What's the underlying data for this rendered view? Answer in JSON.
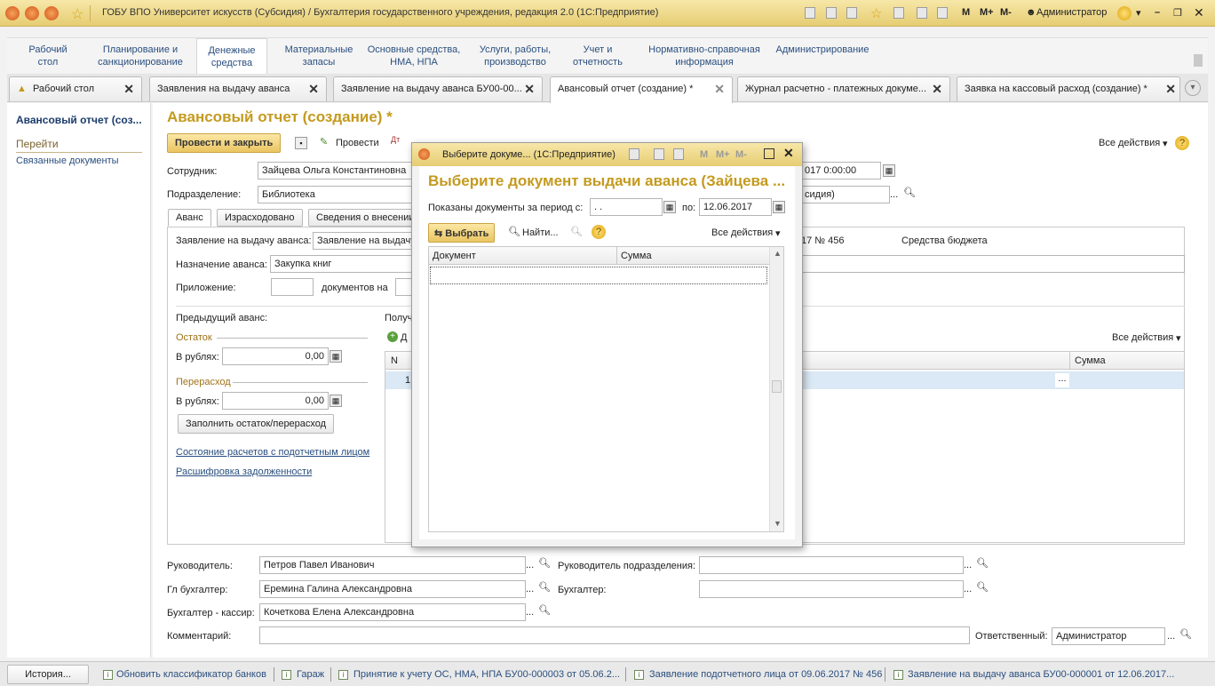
{
  "window": {
    "title": "ГОБУ ВПО Университет искусств (Субсидия) / Бухгалтерия государственного учреждения, редакция 2.0  (1С:Предприятие)",
    "right_buttons": [
      "M",
      "M+",
      "M-"
    ],
    "user": "Администратор"
  },
  "menu": [
    {
      "label": "Рабочий\nстол"
    },
    {
      "label": "Планирование и\nсанкционирование"
    },
    {
      "label": "Денежные\nсредства"
    },
    {
      "label": "Материальные\nзапасы"
    },
    {
      "label": "Основные средства,\nНМА, НПА"
    },
    {
      "label": "Услуги, работы,\nпроизводство"
    },
    {
      "label": "Учет и\nотчетность"
    },
    {
      "label": "Нормативно-справочная\nинформация"
    },
    {
      "label": "Администрирование"
    }
  ],
  "tabs": [
    {
      "label": "Рабочий стол"
    },
    {
      "label": "Заявления на выдачу аванса"
    },
    {
      "label": "Заявление на выдачу аванса БУ00-00..."
    },
    {
      "label": "Авансовый отчет (создание) *"
    },
    {
      "label": "Журнал расчетно - платежных докуме..."
    },
    {
      "label": "Заявка на кассовый расход (создание) *"
    }
  ],
  "left_panel": {
    "title": "Авансовый отчет (соз...",
    "goto": "Перейти",
    "related": "Связанные документы"
  },
  "form": {
    "title": "Авансовый отчет (создание) *",
    "post_close": "Провести и закрыть",
    "post": "Провести",
    "all_actions": "Все действия",
    "employee_label": "Сотрудник:",
    "employee_value": "Зайцева Ольга Константиновна",
    "date_value": "017 0:00:00",
    "dept_label": "Подразделение:",
    "dept_value": "Библиотека",
    "subsidy_value": "сидия)",
    "subtabs": [
      "Аванс",
      "Израсходовано",
      "Сведения о внесении"
    ],
    "advance_request_label": "Заявление на выдачу аванса:",
    "advance_request_value": "Заявление на выдачу",
    "advance_request_tail": "17 № 456",
    "budget_funds": "Средства бюджета",
    "purpose_label": "Назначение аванса:",
    "purpose_value": "Закупка книг",
    "attachment_label": "Приложение:",
    "documents_on": "документов на",
    "prev_advance": "Предыдущий аванс:",
    "received_partial": "Получ",
    "balance": "Остаток",
    "rub_label": "В рублях:",
    "balance_value": "0,00",
    "overspend": "Перерасход",
    "overspend_value": "0,00",
    "fill_button": "Заполнить остаток/перерасход",
    "link_status": "Состояние расчетов с подотчетным лицом",
    "link_debt": "Расшифровка задолженности",
    "add_partial": "Д",
    "all_actions2": "Все действия",
    "grid_n": "N",
    "grid_row_n": "1",
    "grid_sum": "Сумма",
    "head_label": "Руководитель:",
    "head_value": "Петров Павел Иванович",
    "dept_head_label": "Руководитель подразделения:",
    "chief_acc_label": "Гл бухгалтер:",
    "chief_acc_value": "Еремина Галина Александровна",
    "accountant_label": "Бухгалтер:",
    "cashier_label": "Бухгалтер - кассир:",
    "cashier_value": "Кочеткова Елена Александровна",
    "comment_label": "Комментарий:",
    "responsible_label": "Ответственный:",
    "responsible_value": "Администратор"
  },
  "modal": {
    "window_title": "Выберите докуме... (1С:Предприятие)",
    "right_buttons": [
      "M",
      "M+",
      "M-"
    ],
    "heading": "Выберите документ выдачи аванса (Зайцева ...",
    "period_label": "Показаны документы за период с:",
    "period_from": " .  .",
    "period_to_label": "по:",
    "period_to": "12.06.2017",
    "select_button": "Выбрать",
    "find_button": "Найти...",
    "all_actions": "Все действия",
    "col_document": "Документ",
    "col_sum": "Сумма"
  },
  "statusbar": {
    "history": "История...",
    "items": [
      "Обновить классификатор банков",
      "Гараж",
      "Принятие к учету ОС, НМА, НПА БУ00-000003 от 05.06.2...",
      "Заявление подотчетного лица от 09.06.2017 № 456",
      "Заявление на выдачу аванса БУ00-000001 от 12.06.2017..."
    ]
  },
  "colors": {
    "accent_yellow": "#eac561",
    "title_gold": "#c49a1e",
    "link_blue": "#2a4f7f",
    "modal_heading": "#c49a1e"
  }
}
